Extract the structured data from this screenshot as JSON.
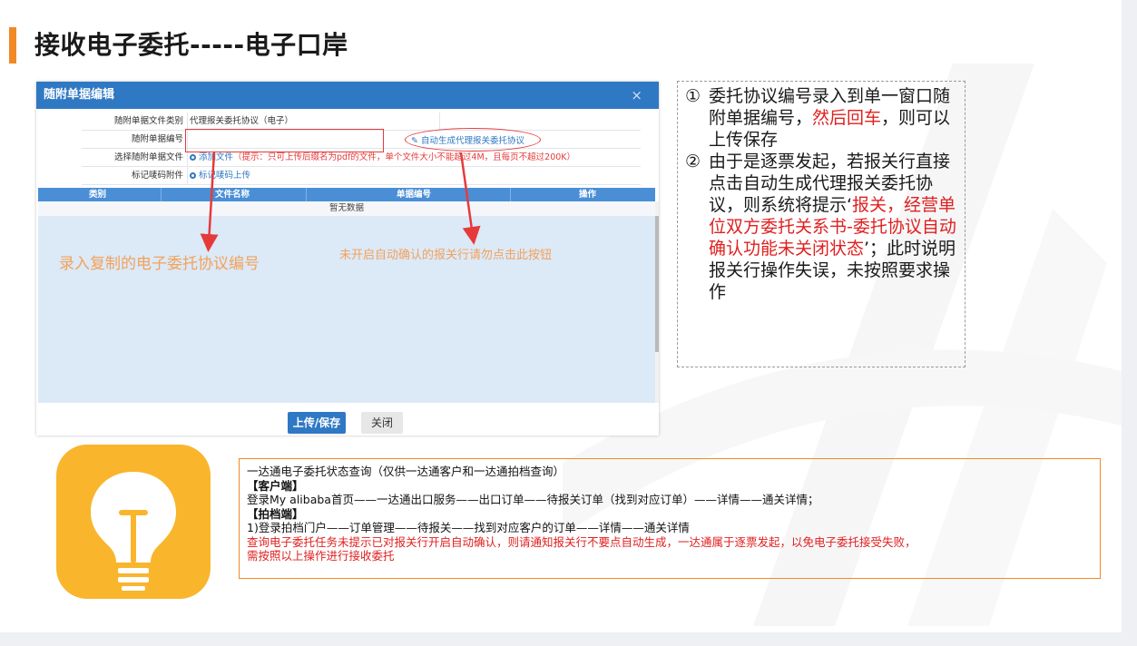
{
  "slide": {
    "title": "接收电子委托-----电子口岸"
  },
  "dialog": {
    "title": "随附单据编辑",
    "close_glyph": "×",
    "rows": [
      {
        "label": "随附单据文件类别",
        "value": "代理报关委托协议（电子）"
      },
      {
        "label": "随附单据编号",
        "value": ""
      },
      {
        "label": "选择随附单据文件",
        "link": "添加文件",
        "hint": "（提示：只可上传后缀名为pdf的文件，单个文件大小不能超过4M，且每页不超过200K）"
      },
      {
        "label": "标记唛码附件",
        "link": "标记唛码上传"
      }
    ],
    "auto_generate_link": "自动生成代理报关委托协议",
    "table": {
      "columns": [
        "类别",
        "文件名称",
        "单据编号",
        "操作"
      ],
      "empty_text": "暂无数据"
    },
    "buttons": {
      "save": "上传/保存",
      "close": "关闭"
    }
  },
  "annotations": {
    "left": "录入复制的电子委托协议编号",
    "right": "未开启自动确认的报关行请勿点击此按钮"
  },
  "instructions": {
    "item1": {
      "num": "①",
      "text_a": "委托协议编号录入到单一窗口随附单据编号，",
      "text_red": "然后回车",
      "text_b": "，则可以上传保存"
    },
    "item2": {
      "num": "②",
      "text_a": "由于是逐票发起，若报关行直接点击自动生成代理报关委托协议，则系统将提示‘",
      "text_red": "报关，经营单位双方委托关系书-委托协议自动确认功能未关闭状态",
      "text_b": "’；此时说明报关行操作失误，未按照要求操作"
    }
  },
  "query_box": {
    "line1": "一达通电子委托状态查询（仅供一达通客户和一达通拍档查询）",
    "client_header": "【客户端】",
    "client_path": "登录My alibaba首页——一达通出口服务——出口订单——待报关订单（找到对应订单）——详情——通关详情；",
    "partner_header": "【拍档端】",
    "partner_path": " 1)登录拍档门户——订单管理——待报关——找到对应客户的订单——详情——通关详情",
    "warning_1": "查询电子委托任务未提示已对报关行开启自动确认，则请通知报关行不要点自动生成，一达通属于逐票发起，以免电子委托接受失败，",
    "warning_2": "需按照以上操作进行接收委托"
  },
  "colors": {
    "accent_orange": "#f08a24",
    "dialog_blue": "#2f78c3",
    "highlight_red": "#e02020",
    "bulb_yellow": "#f9b52c"
  },
  "icons": [
    "edit-icon",
    "plus-circle-icon",
    "lightbulb-icon",
    "close-icon"
  ]
}
